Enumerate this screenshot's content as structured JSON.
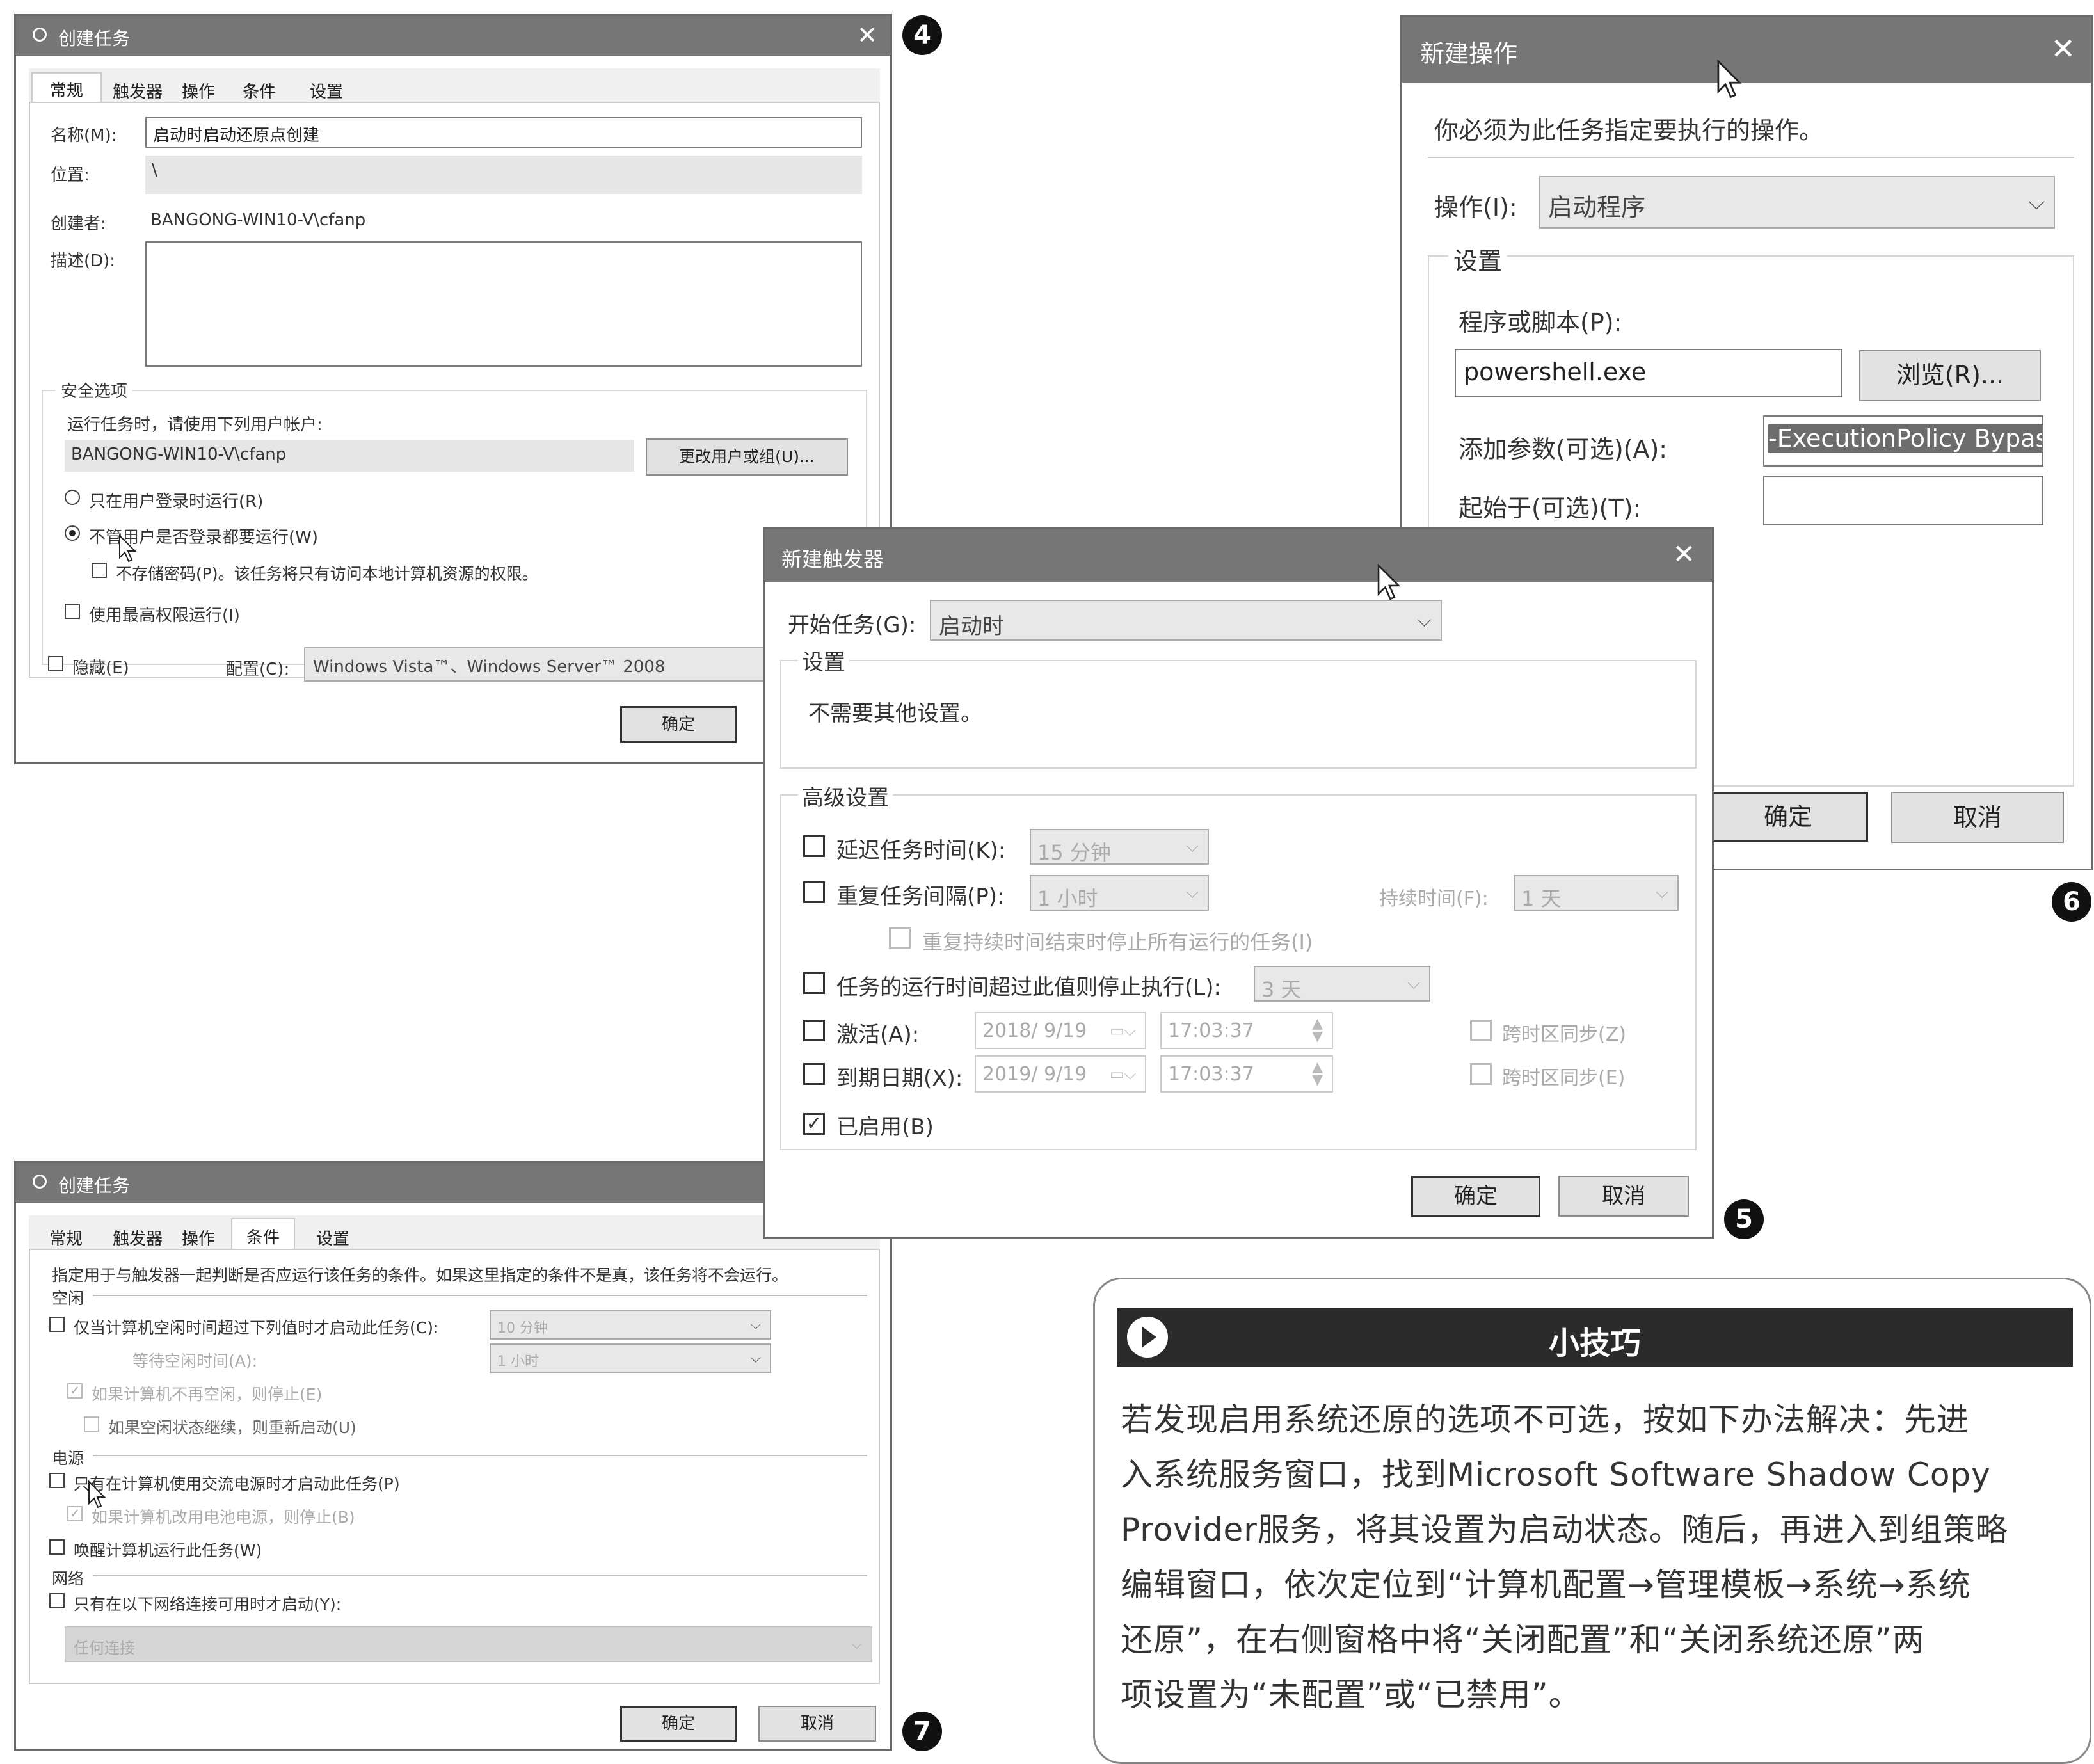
{
  "markers": {
    "m4": "4",
    "m5": "5",
    "m6": "6",
    "m7": "7"
  },
  "dlg4": {
    "title": "创建任务",
    "tabs": [
      "常规",
      "触发器",
      "操作",
      "条件",
      "设置"
    ],
    "name_label": "名称(M):",
    "name_value": "启动时启动还原点创建",
    "location_label": "位置:",
    "location_value": "\\",
    "author_label": "创建者:",
    "author_value": "BANGONG-WIN10-V\\cfanp",
    "desc_label": "描述(D):",
    "security_legend": "安全选项",
    "run_as_text": "运行任务时，请使用下列用户帐户:",
    "user_value": "BANGONG-WIN10-V\\cfanp",
    "change_user_button": "更改用户或组(U)...",
    "radio_logged_on": "只在用户登录时运行(R)",
    "radio_whether": "不管用户是否登录都要运行(W)",
    "no_store_password": "不存储密码(P)。该任务将只有访问本地计算机资源的权限。",
    "highest_priv": "使用最高权限运行(I)",
    "hidden": "隐藏(E)",
    "config_label": "配置(C):",
    "config_value": "Windows Vista™、Windows Server™ 2008",
    "ok": "确定"
  },
  "dlg6": {
    "title": "新建操作",
    "intro": "你必须为此任务指定要执行的操作。",
    "action_label": "操作(I):",
    "action_value": "启动程序",
    "settings_legend": "设置",
    "program_label": "程序或脚本(P):",
    "program_value": "powershell.exe",
    "browse_button": "浏览(R)...",
    "args_label": "添加参数(可选)(A):",
    "args_value": "-ExecutionPolicy Bypas",
    "start_in_label": "起始于(可选)(T):",
    "start_in_value": "",
    "ok": "确定",
    "cancel": "取消"
  },
  "dlg5": {
    "title": "新建触发器",
    "begin_label": "开始任务(G):",
    "begin_value": "启动时",
    "settings_legend": "设置",
    "no_settings": "不需要其他设置。",
    "advanced_legend": "高级设置",
    "delay_label": "延迟任务时间(K):",
    "delay_value": "15 分钟",
    "repeat_label": "重复任务间隔(P):",
    "repeat_value": "1 小时",
    "duration_label": "持续时间(F):",
    "duration_value": "1 天",
    "stop_all_label": "重复持续时间结束时停止所有运行的任务(I)",
    "stop_longer_label": "任务的运行时间超过此值则停止执行(L):",
    "stop_longer_value": "3 天",
    "activate_label": "激活(A):",
    "activate_date": "2018/ 9/19",
    "activate_time": "17:03:37",
    "expire_label": "到期日期(X):",
    "expire_date": "2019/ 9/19",
    "expire_time": "17:03:37",
    "sync_tz_1": "跨时区同步(Z)",
    "sync_tz_2": "跨时区同步(E)",
    "enabled_label": "已启用(B)",
    "ok": "确定",
    "cancel": "取消"
  },
  "dlg7": {
    "title": "创建任务",
    "tabs": [
      "常规",
      "触发器",
      "操作",
      "条件",
      "设置"
    ],
    "intro": "指定用于与触发器一起判断是否应运行该任务的条件。如果这里指定的条件不是真，该任务将不会运行。",
    "idle_legend": "空闲",
    "idle_start": "仅当计算机空闲时间超过下列值时才启动此任务(C):",
    "idle_value": "10 分钟",
    "wait_idle": "等待空闲时间(A):",
    "wait_value": "1 小时",
    "stop_if_not_idle": "如果计算机不再空闲，则停止(E)",
    "restart_idle": "如果空闲状态继续，则重新启动(U)",
    "power_legend": "电源",
    "ac_only": "只有在计算机使用交流电源时才启动此任务(P)",
    "stop_battery": "如果计算机改用电池电源，则停止(B)",
    "wake": "唤醒计算机运行此任务(W)",
    "network_legend": "网络",
    "network_only": "只有在以下网络连接可用时才启动(Y):",
    "network_value": "任何连接",
    "ok": "确定",
    "cancel": "取消"
  },
  "tip": {
    "title": "小技巧",
    "lines": [
      "若发现启用系统还原的选项不可选，按如下办法解决：先进",
      "入系统服务窗口，找到Microsoft Software Shadow Copy",
      "Provider服务，将其设置为启动状态。随后，再进入到组策略",
      "编辑窗口，依次定位到“计算机配置→管理模板→系统→系统",
      "还原”，在右侧窗格中将“关闭配置”和“关闭系统还原”两",
      "项设置为“未配置”或“已禁用”。"
    ]
  }
}
